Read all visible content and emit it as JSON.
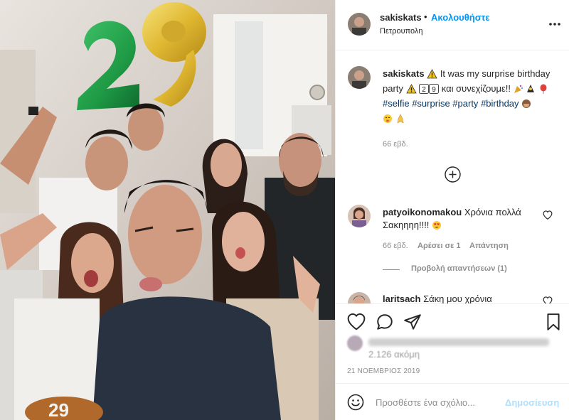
{
  "post": {
    "username": "sakiskats",
    "follow_label": "Ακολουθήστε",
    "location": "Πετρουπολη",
    "caption_text_1": "It was my surprise birthday party",
    "digit_1": "2",
    "digit_2": "9",
    "caption_text_2": "και συνεχίζουμε!!",
    "hashtags": [
      "#selfie",
      "#surprise",
      "#party",
      "#birthday"
    ],
    "caption_time": "66 εβδ.",
    "date": "21 ΝΟΕΜΒΡΙΟΣ 2019",
    "balloon_digits": "29"
  },
  "comments": [
    {
      "username": "patyoikonomakou",
      "text": "Χρόνια πολλά Σακηηηη!!!!",
      "time": "66 εβδ.",
      "likes": "Αρέσει σε 1",
      "reply_label": "Απάντηση",
      "view_replies": "Προβολή απαντήσεων (1)"
    },
    {
      "username": "laritsach",
      "text": "Σάκη μου χρόνια"
    }
  ],
  "likes": {
    "more_text": "2.126 ακόμη"
  },
  "add_comment": {
    "placeholder": "Προσθέστε ένα σχόλιο...",
    "post_label": "Δημοσίευση"
  },
  "colors": {
    "accent": "#0095f6",
    "post_disabled": "#b2dffc",
    "secondary_text": "#8e8e8e",
    "hashtag": "#00376b",
    "balloon_green": "#1f9a45",
    "balloon_gold": "#e8c640"
  }
}
